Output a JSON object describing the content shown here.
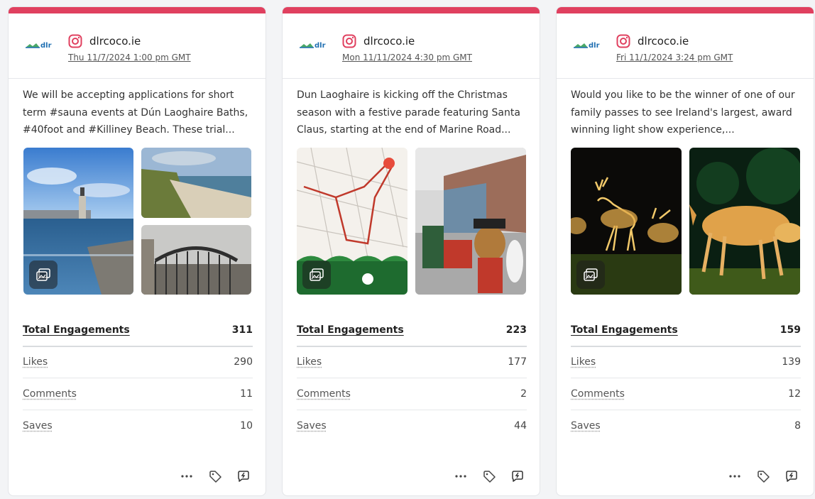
{
  "cards": [
    {
      "handle": "dlrcoco.ie",
      "date": "Thu 11/7/2024 1:00 pm GMT",
      "text": "We will be accepting applications for short term #sauna events at Dún Laoghaire Baths, #40foot and #Killiney Beach. These trial...",
      "metrics": {
        "total_label": "Total Engagements",
        "total": "311",
        "likes_label": "Likes",
        "likes": "290",
        "comments_label": "Comments",
        "comments": "11",
        "saves_label": "Saves",
        "saves": "10"
      }
    },
    {
      "handle": "dlrcoco.ie",
      "date": "Mon 11/11/2024 4:30 pm GMT",
      "text": "Dun Laoghaire is kicking off the Christmas season with a festive parade featuring Santa Claus, starting at the end of Marine Road...",
      "metrics": {
        "total_label": "Total Engagements",
        "total": "223",
        "likes_label": "Likes",
        "likes": "177",
        "comments_label": "Comments",
        "comments": "2",
        "saves_label": "Saves",
        "saves": "44"
      }
    },
    {
      "handle": "dlrcoco.ie",
      "date": "Fri 11/1/2024 3:24 pm GMT",
      "text": "Would you like to be the winner of one of our family passes to see Ireland's largest, award winning light show experience,...",
      "metrics": {
        "total_label": "Total Engagements",
        "total": "159",
        "likes_label": "Likes",
        "likes": "139",
        "comments_label": "Comments",
        "comments": "12",
        "saves_label": "Saves",
        "saves": "8"
      }
    }
  ],
  "logo_text": "dlr",
  "icons": {
    "platform": "instagram-icon",
    "gallery": "gallery-icon",
    "more": "more-icon",
    "tag": "tag-icon",
    "reply": "reply-icon"
  },
  "colors": {
    "accent": "#e0405f",
    "instagram": "#e0405f"
  }
}
